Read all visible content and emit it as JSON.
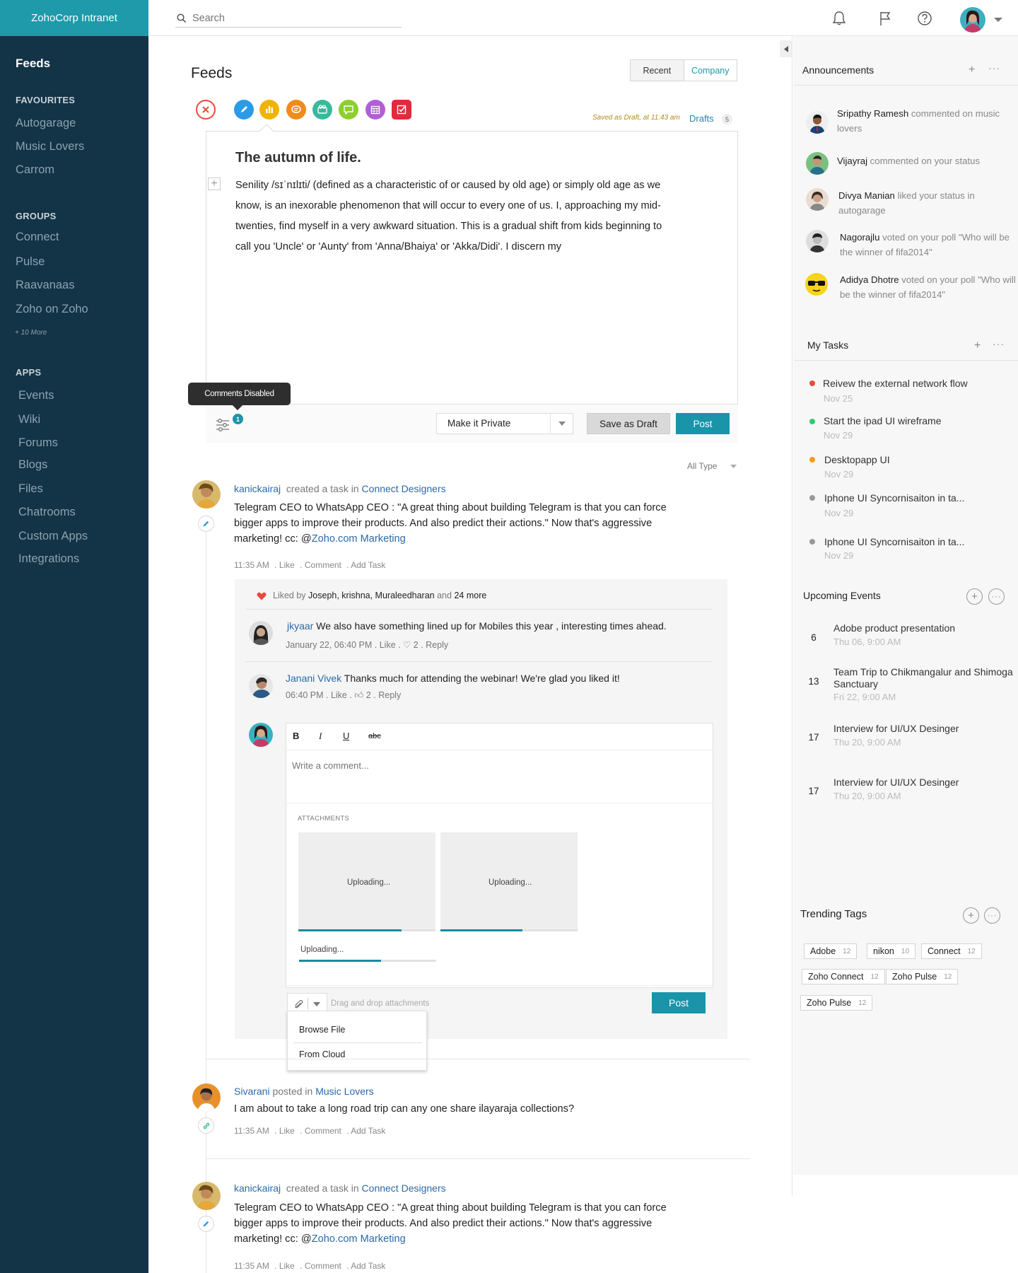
{
  "app": {
    "brand": "ZohoCorp Intranet"
  },
  "sidebar": {
    "active": "Feeds",
    "favourites_heading": "FAVOURITES",
    "favourites": [
      "Autogarage",
      "Music Lovers",
      "Carrom"
    ],
    "groups_heading": "GROUPS",
    "groups": [
      "Connect",
      "Pulse",
      "Raavanaas",
      "Zoho on Zoho"
    ],
    "groups_more": "+ 10 More",
    "apps_heading": "APPS",
    "apps": [
      "Events",
      "Wiki",
      "Forums",
      "Blogs",
      "Files",
      "Chatrooms",
      "Custom Apps",
      "Integrations"
    ]
  },
  "topbar": {
    "search_placeholder": "Search",
    "icons": [
      "bell-icon",
      "flag-icon",
      "help-icon",
      "avatar",
      "chevron-down-icon"
    ]
  },
  "feeds": {
    "title": "Feeds",
    "tabs": [
      "Recent",
      "Company"
    ],
    "active_tab": "Company",
    "saved_text": "Saved as Draft, at 11:43 am",
    "drafts_label": "Drafts",
    "drafts_count": "5",
    "post_types": [
      {
        "icon": "close-icon",
        "color": "#e74c3c"
      },
      {
        "icon": "pencil-icon",
        "color": "#2b9be6"
      },
      {
        "icon": "chart-icon",
        "color": "#f0b400"
      },
      {
        "icon": "chat-icon",
        "color": "#f08c1a"
      },
      {
        "icon": "video-icon",
        "color": "#3bb89c"
      },
      {
        "icon": "comment-icon",
        "color": "#8ccf2e"
      },
      {
        "icon": "calendar-icon",
        "color": "#b05fd6"
      },
      {
        "icon": "task-icon",
        "color": "#e02b3c"
      }
    ]
  },
  "composer": {
    "title": "The autumn of life.",
    "body": "Senility /sɪˈnɪlɪti/ (defined as a characteristic of or caused by old age) or simply old age as we know, is an inexorable phenomenon that will occur to every one of us. I, approaching my mid-twenties, find myself in a very awkward situation. This is a gradual shift from kids beginning to call you 'Uncle' or 'Aunty' from 'Anna/Bhaiya' or 'Akka/Didi'. I discern my",
    "tooltip": "Comments Disabled",
    "settings_badge": "1",
    "privacy": "Make it Private",
    "save_draft": "Save as Draft",
    "post": "Post"
  },
  "filter": {
    "label": "All Type"
  },
  "posts": [
    {
      "author": "kanickairaj",
      "verb": "created a task in",
      "group": "Connect Designers",
      "text_lines": [
        "Telegram CEO to WhatsApp CEO : \"A great thing about building Telegram is that you can force",
        "bigger apps to improve their products. And also predict their actions.\" Now that's aggressive"
      ],
      "text_tail": "marketing! cc: @",
      "mention": "Zoho.com Marketing",
      "time": "11:35 AM",
      "actions": [
        "Like",
        "Comment",
        "Add Task"
      ]
    },
    {
      "author": "Sivarani",
      "verb": "posted in",
      "group": "Music Lovers",
      "text": "I am about to take a long road trip can any one share ilayaraja collections?",
      "time": "11:35 AM",
      "actions": [
        "Like",
        "Comment",
        "Add Task"
      ]
    },
    {
      "author": "kanickairaj",
      "verb": "created a task in",
      "group": "Connect Designers",
      "text_lines": [
        "Telegram CEO to WhatsApp CEO : \"A great thing about building Telegram is that you can force",
        "bigger apps to improve their products. And also predict their actions.\" Now that's aggressive"
      ],
      "text_tail": "marketing! cc: @",
      "mention": "Zoho.com Marketing",
      "time": "11:35 AM",
      "actions": [
        "Like",
        "Comment",
        "Add Task"
      ]
    }
  ],
  "likes": {
    "prefix": "Liked by",
    "names": "Joseph, krishna, Muraleedharan",
    "and": "and",
    "more": "24 more"
  },
  "comments": [
    {
      "author": "jkyaar",
      "text": "We also have something lined up for Mobiles this year , interesting times ahead.",
      "date": "January 22, 06:40 PM",
      "like": "Like",
      "count": "2",
      "reply": "Reply"
    },
    {
      "author": "Janani Vivek",
      "text": "Thanks much for attending the webinar! We're glad you liked it!",
      "date": "06:40 PM",
      "like": "Like",
      "count": "2",
      "reply": "Reply"
    }
  ],
  "comment_editor": {
    "format": [
      "B",
      "I",
      "U",
      "abc"
    ],
    "placeholder": "Write a comment...",
    "attachments_label": "ATTACHMENTS",
    "uploads": [
      {
        "label": "Uploading...",
        "progress": 0.75
      },
      {
        "label": "Uploading...",
        "progress": 0.6
      },
      {
        "label": "Uploading...",
        "progress": 0.6
      }
    ],
    "drop_hint": "Drag and drop attachments",
    "post": "Post",
    "menu": [
      "Browse File",
      "From Cloud"
    ]
  },
  "announcements": {
    "title": "Announcements",
    "items": [
      {
        "name": "Sripathy Ramesh",
        "text": " commented on music lovers"
      },
      {
        "name": "Vijayraj",
        "text": " commented on your status"
      },
      {
        "name": "Divya Manian",
        "text": " liked your status in autogarage"
      },
      {
        "name": "Nagorajlu",
        "text": " voted on your poll \"Who will be the winner of fifa2014\""
      },
      {
        "name": "Adidya Dhotre",
        "text": " voted on your poll \"Who will be the winner of fifa2014\""
      }
    ]
  },
  "tasks": {
    "title": "My Tasks",
    "items": [
      {
        "name": "Reivew the external network flow",
        "date": "Nov 25",
        "color": "#e74c3c"
      },
      {
        "name": "Start the ipad UI wireframe",
        "date": "Nov 29",
        "color": "#2ecc71"
      },
      {
        "name": "Desktopapp UI",
        "date": "Nov 29",
        "color": "#f39c12"
      },
      {
        "name": "Iphone UI Syncornisaiton in ta...",
        "date": "Nov 29",
        "color": "#999999"
      },
      {
        "name": "Iphone UI Syncornisaiton in ta...",
        "date": "Nov 29",
        "color": "#999999"
      }
    ]
  },
  "events": {
    "title": "Upcoming Events",
    "items": [
      {
        "day": "6",
        "name": "Adobe product presentation",
        "date": "Thu 06, 9:00 AM"
      },
      {
        "day": "13",
        "name": "Team Trip to Chikmangalur and Shimoga Sanctuary",
        "date": "Fri 22, 9:00 AM"
      },
      {
        "day": "17",
        "name": "Interview for UI/UX Desinger",
        "date": "Thu 20, 9:00 AM"
      },
      {
        "day": "17",
        "name": "Interview for UI/UX Desinger",
        "date": "Thu 20, 9:00 AM"
      }
    ]
  },
  "tags": {
    "title": "Trending Tags",
    "items": [
      {
        "name": "Adobe",
        "count": "12"
      },
      {
        "name": "nikon",
        "count": "10"
      },
      {
        "name": "Connect",
        "count": "12"
      },
      {
        "name": "Zoho Connect",
        "count": "12"
      },
      {
        "name": "Zoho Pulse",
        "count": "12"
      },
      {
        "name": "Zoho Pulse",
        "count": "12"
      }
    ]
  },
  "colors": {
    "sidebar": "#133346",
    "brand": "#1e9aab",
    "accent": "#1a94a8",
    "link": "#2a6aa8"
  }
}
